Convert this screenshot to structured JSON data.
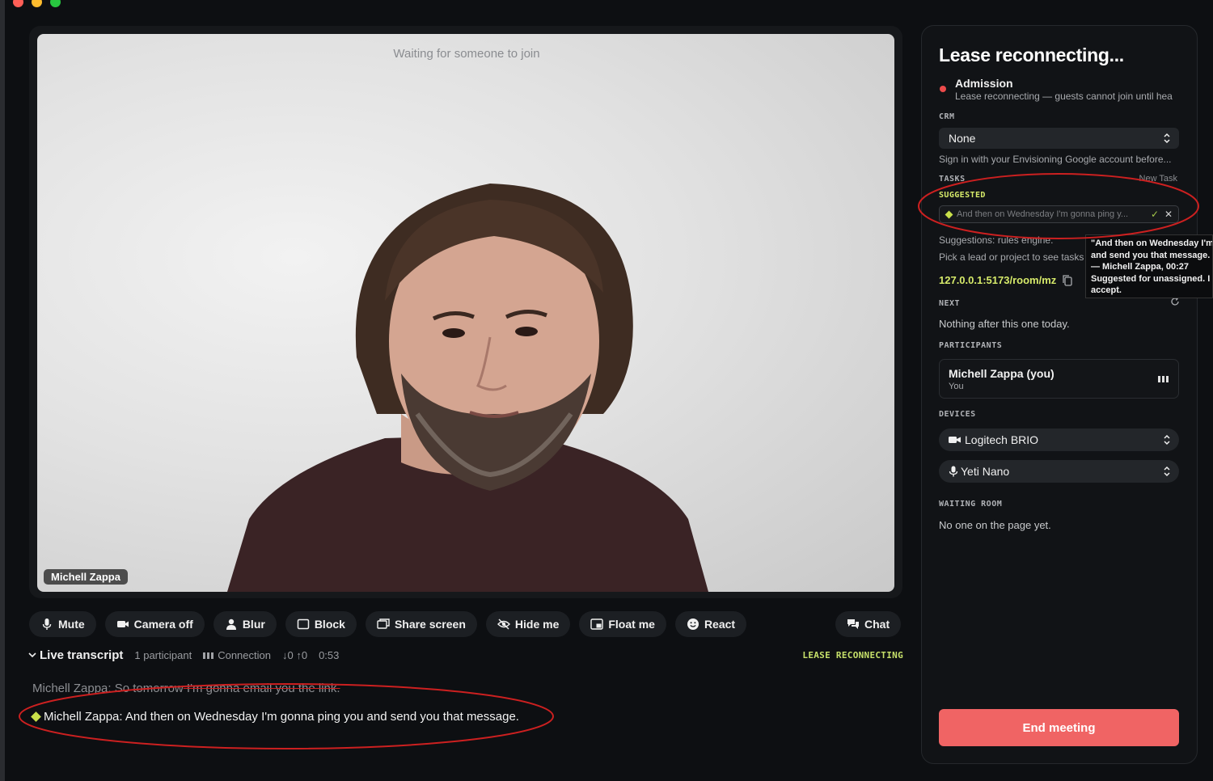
{
  "stage": {
    "waiting_text": "Waiting for someone to join",
    "name_tag": "Michell Zappa"
  },
  "controls": {
    "mute": "Mute",
    "camera_off": "Camera off",
    "blur": "Blur",
    "block": "Block",
    "share_screen": "Share screen",
    "hide_me": "Hide me",
    "float_me": "Float me",
    "react": "React",
    "chat": "Chat"
  },
  "transcript": {
    "title": "Live transcript",
    "participants": "1 participant",
    "connection": "Connection",
    "traffic": "↓0 ↑0",
    "elapsed": "0:53",
    "status": "LEASE RECONNECTING",
    "line1_prefix": "Michell Zappa: So tomorrow",
    "line1_struck": " I'm gonna email you the link.",
    "line2": "Michell Zappa: And then on Wednesday I'm gonna ping you and send you that message."
  },
  "panel": {
    "title": "Lease reconnecting...",
    "admission_label": "Admission",
    "admission_desc": "Lease reconnecting — guests cannot join until hea",
    "crm_label": "CRM",
    "crm_value": "None",
    "crm_hint": "Sign in with your Envisioning Google account before...",
    "tasks_label": "TASKS",
    "new_task": "New Task",
    "suggested_label": "SUGGESTED",
    "suggested_text": "And then on Wednesday I'm gonna ping y...",
    "suggestions_engine": "Suggestions: rules engine.",
    "pick_hint": "Pick a lead or project to see tasks",
    "room_url": "127.0.0.1:5173/room/mz",
    "next_label": "NEXT",
    "next_value": "Nothing after this one today.",
    "participants_label": "PARTICIPANTS",
    "participant_name": "Michell Zappa (you)",
    "participant_role": "You",
    "devices_label": "DEVICES",
    "camera_device": "Logitech BRIO",
    "mic_device": "Yeti Nano",
    "waiting_room_label": "WAITING ROOM",
    "waiting_room_value": "No one on the page yet.",
    "end_meeting": "End meeting"
  },
  "tooltip": {
    "line1": "\"And then on Wednesday I'm",
    "line2": "and send you that message.",
    "line3": "— Michell Zappa, 00:27",
    "line4": "Suggested for unassigned. I",
    "line5": "accept."
  },
  "colors": {
    "accent": "#d6ea6a",
    "danger": "#f06464",
    "annotation": "#cc2020"
  }
}
